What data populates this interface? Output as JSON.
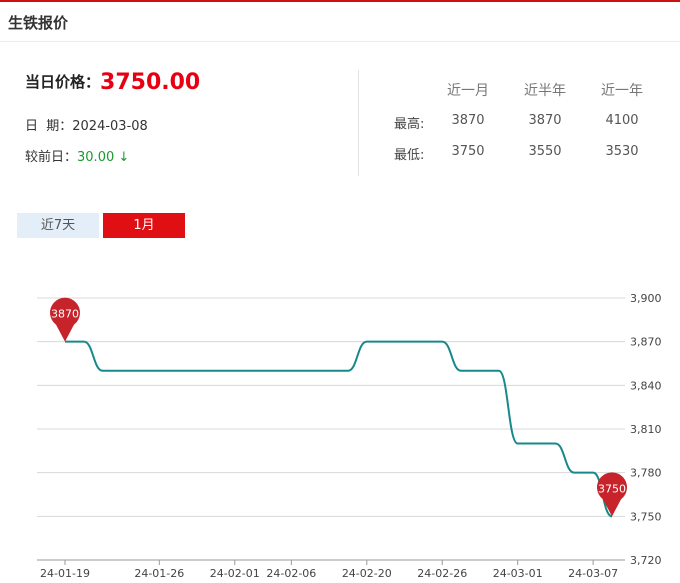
{
  "header": {
    "title": "生铁报价"
  },
  "price": {
    "label": "当日价格：",
    "value": "3750.00"
  },
  "date": {
    "label": "日  期：",
    "value": "2024-03-08"
  },
  "change": {
    "label": "较前日：",
    "value": "30.00",
    "arrow": "↓"
  },
  "stats": {
    "headers": [
      "近一月",
      "近半年",
      "近一年"
    ],
    "rows": [
      {
        "label": "最高:",
        "values": [
          "3870",
          "3870",
          "4100"
        ]
      },
      {
        "label": "最低:",
        "values": [
          "3750",
          "3550",
          "3530"
        ]
      }
    ]
  },
  "tabs": [
    {
      "label": "近7天",
      "active": false
    },
    {
      "label": "1月",
      "active": true
    }
  ],
  "colors": {
    "accent": "#e00f14",
    "line": "#17898a",
    "marker": "#c6242a",
    "down": "#1a9b2c"
  },
  "chart_data": {
    "type": "line",
    "x": [
      "24-01-19",
      "24-01-22",
      "24-01-23",
      "24-01-24",
      "24-01-25",
      "24-01-26",
      "24-01-29",
      "24-01-30",
      "24-01-31",
      "24-02-01",
      "24-02-02",
      "24-02-05",
      "24-02-06",
      "24-02-07",
      "24-02-08",
      "24-02-19",
      "24-02-20",
      "24-02-21",
      "24-02-22",
      "24-02-23",
      "24-02-26",
      "24-02-27",
      "24-02-28",
      "24-02-29",
      "24-03-01",
      "24-03-04",
      "24-03-05",
      "24-03-06",
      "24-03-07",
      "24-03-08"
    ],
    "x_tick_labels": [
      "24-01-19",
      "24-01-26",
      "24-02-01",
      "24-02-06",
      "24-02-20",
      "24-02-26",
      "24-03-01",
      "24-03-07"
    ],
    "series": [
      {
        "values": [
          3870,
          3870,
          3850,
          3850,
          3850,
          3850,
          3850,
          3850,
          3850,
          3850,
          3850,
          3850,
          3850,
          3850,
          3850,
          3850,
          3870,
          3870,
          3870,
          3870,
          3870,
          3850,
          3850,
          3850,
          3800,
          3800,
          3800,
          3780,
          3780,
          3750
        ]
      }
    ],
    "ylim": [
      3720,
      3900
    ],
    "yticks": [
      3720,
      3750,
      3780,
      3810,
      3840,
      3870,
      3900
    ],
    "ytick_labels": [
      "3,720",
      "3,750",
      "3,780",
      "3,810",
      "3,840",
      "3,870",
      "3,900"
    ],
    "markers": [
      {
        "label": "3870",
        "value": 3870,
        "x": "24-01-19"
      },
      {
        "label": "3750",
        "value": 3750,
        "x": "24-03-08"
      }
    ],
    "grid": true,
    "yaxis_position": "right"
  }
}
